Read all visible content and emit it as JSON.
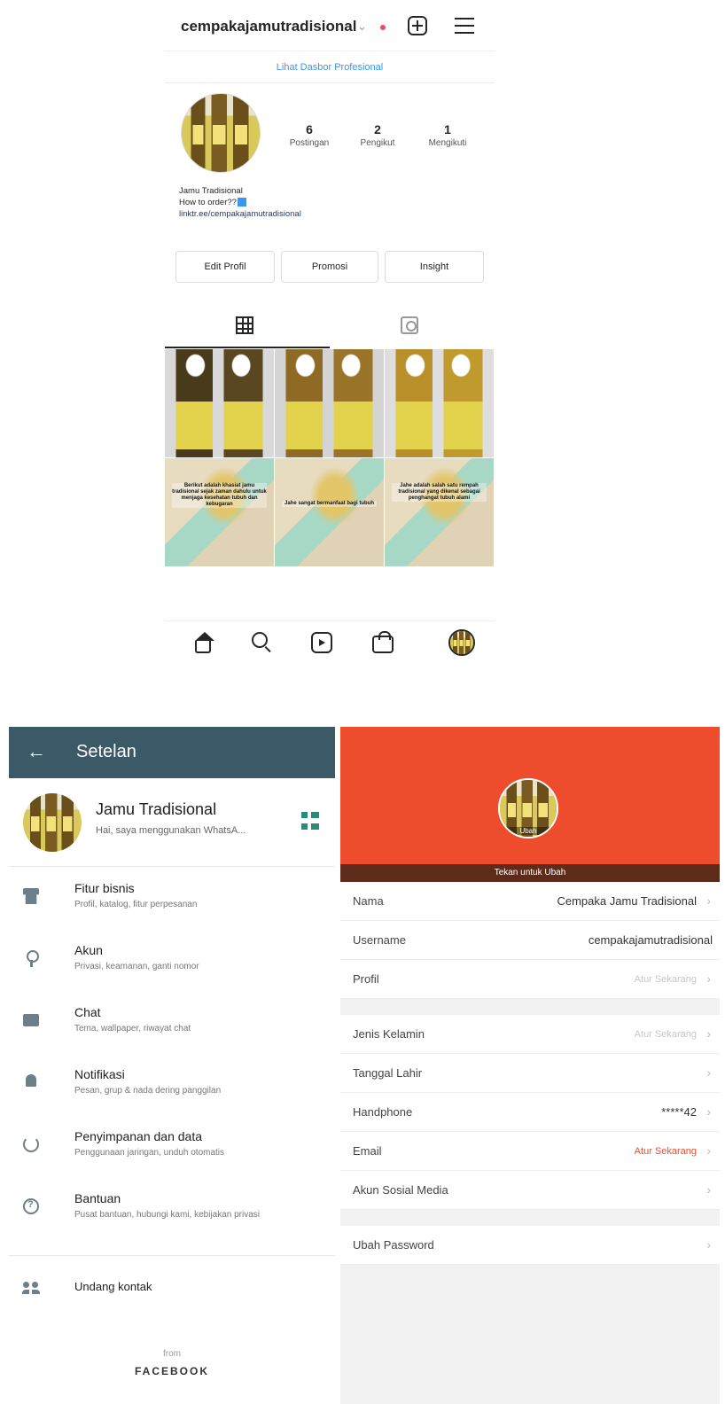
{
  "instagram": {
    "username": "cempakajamutradisional",
    "dashboard_link": "Lihat Dasbor Profesional",
    "stats": [
      {
        "value": "6",
        "label": "Postingan"
      },
      {
        "value": "2",
        "label": "Pengikut"
      },
      {
        "value": "1",
        "label": "Mengikuti"
      }
    ],
    "bio": {
      "name": "Jamu Tradisional",
      "line2": "How to order??",
      "link": "linktr.ee/cempakajamutradisional"
    },
    "buttons": [
      "Edit Profil",
      "Promosi",
      "Insight"
    ],
    "posts": [
      {
        "kind": "product",
        "caption": ""
      },
      {
        "kind": "product",
        "caption": ""
      },
      {
        "kind": "product",
        "caption": ""
      },
      {
        "kind": "ginger",
        "caption": "Berikut adalah khasiat jamu tradisional sejak zaman dahulu untuk menjaga kesehatan tubuh dan kebugaran"
      },
      {
        "kind": "ginger",
        "caption": "Jahe sangat bermanfaat bagi tubuh"
      },
      {
        "kind": "ginger",
        "caption": "Jahe adalah salah satu rempah tradisional yang dikenal sebagai penghangat tubuh alami"
      }
    ],
    "nav": [
      "home-icon",
      "search-icon",
      "reels-icon",
      "shop-icon",
      "profile-avatar"
    ],
    "accent": "#3897f0"
  },
  "whatsapp": {
    "title": "Setelan",
    "profile_name": "Jamu Tradisional",
    "profile_status": "Hai, saya menggunakan WhatsA...",
    "items": [
      {
        "icon": "store-icon",
        "title": "Fitur bisnis",
        "subtitle": "Profil, katalog, fitur perpesanan"
      },
      {
        "icon": "key-icon",
        "title": "Akun",
        "subtitle": "Privasi, keamanan, ganti nomor"
      },
      {
        "icon": "chat-icon",
        "title": "Chat",
        "subtitle": "Tema, wallpaper, riwayat chat"
      },
      {
        "icon": "bell-icon",
        "title": "Notifikasi",
        "subtitle": "Pesan, grup & nada dering panggilan"
      },
      {
        "icon": "data-usage-icon",
        "title": "Penyimpanan dan data",
        "subtitle": "Penggunaan jaringan, unduh otomatis"
      },
      {
        "icon": "help-icon",
        "title": "Bantuan",
        "subtitle": "Pusat bantuan, hubungi kami, kebijakan privasi"
      }
    ],
    "invite": "Undang kontak",
    "from": "from",
    "brand": "FACEBOOK",
    "header_color": "#3b5967"
  },
  "shopee": {
    "avatar_caption": "Ubah",
    "tap_to_change": "Tekan untuk Ubah",
    "rows": [
      {
        "key": "Nama",
        "value": "Cempaka Jamu Tradisional",
        "style": "normal",
        "chevron": true
      },
      {
        "key": "Username",
        "value": "cempakajamutradisional",
        "style": "normal",
        "chevron": false
      },
      {
        "key": "Profil",
        "value": "Atur Sekarang",
        "style": "muted",
        "chevron": true
      },
      {
        "key": "Jenis Kelamin",
        "value": "Atur Sekarang",
        "style": "muted",
        "chevron": true
      },
      {
        "key": "Tanggal Lahir",
        "value": "",
        "style": "normal",
        "chevron": true
      },
      {
        "key": "Handphone",
        "value": "*****42",
        "style": "normal",
        "chevron": true
      },
      {
        "key": "Email",
        "value": "Atur Sekarang",
        "style": "orange",
        "chevron": true
      },
      {
        "key": "Akun Sosial Media",
        "value": "",
        "style": "normal",
        "chevron": true
      },
      {
        "key": "Ubah Password",
        "value": "",
        "style": "normal",
        "chevron": true
      }
    ],
    "chevron": "›",
    "brand_color": "#ee4d2d"
  }
}
